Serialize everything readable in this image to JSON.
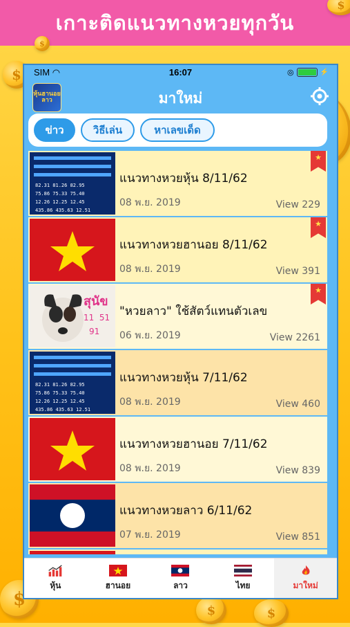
{
  "banner": {
    "text": "เกาะติดแนวทางหวยทุกวัน"
  },
  "status_bar": {
    "carrier": "SIM",
    "time": "16:07"
  },
  "nav": {
    "title": "มาใหม่",
    "logo_text": "หุ้นฮานอยลาว"
  },
  "tabs": [
    {
      "label": "ข่าว",
      "active": true
    },
    {
      "label": "วิธีเล่น",
      "active": false
    },
    {
      "label": "หาเลขเด็ด",
      "active": false
    }
  ],
  "items": [
    {
      "title": "แนวทางหวยหุ้น 8/11/62",
      "date": "08 พ.ย. 2019",
      "views": "View 229",
      "thumb": "stock",
      "ribbon": true
    },
    {
      "title": "แนวทางหวยฮานอย 8/11/62",
      "date": "08 พ.ย. 2019",
      "views": "View 391",
      "thumb": "vietnam",
      "ribbon": true
    },
    {
      "title": "\"หวยลาว\" ใช้สัตว์แทนตัวเลข",
      "date": "06 พ.ย. 2019",
      "views": "View 2261",
      "thumb": "dog",
      "ribbon": true,
      "thumb_text": "สุนัข",
      "thumb_nums": "11  51",
      "thumb_num2": "91"
    },
    {
      "title": "แนวทางหวยหุ้น 7/11/62",
      "date": "08 พ.ย. 2019",
      "views": "View 460",
      "thumb": "stock",
      "ribbon": false
    },
    {
      "title": "แนวทางหวยฮานอย 7/11/62",
      "date": "08 พ.ย. 2019",
      "views": "View 839",
      "thumb": "vietnam",
      "ribbon": false
    },
    {
      "title": "แนวทางหวยลาว 6/11/62",
      "date": "07 พ.ย. 2019",
      "views": "View 851",
      "thumb": "laos",
      "ribbon": false
    }
  ],
  "tabbar": [
    {
      "label": "หุ้น",
      "icon": "chart-icon",
      "active": false
    },
    {
      "label": "ฮานอย",
      "icon": "vietnam-flag-icon",
      "active": false
    },
    {
      "label": "ลาว",
      "icon": "laos-flag-icon",
      "active": false
    },
    {
      "label": "ไทย",
      "icon": "thailand-flag-icon",
      "active": false
    },
    {
      "label": "มาใหม่",
      "icon": "fire-icon",
      "active": true
    }
  ],
  "colors": {
    "banner": "#f25aa8",
    "nav_blue": "#5db8f5",
    "accent_red": "#e53935",
    "background_yellow": "#ffc21a"
  }
}
